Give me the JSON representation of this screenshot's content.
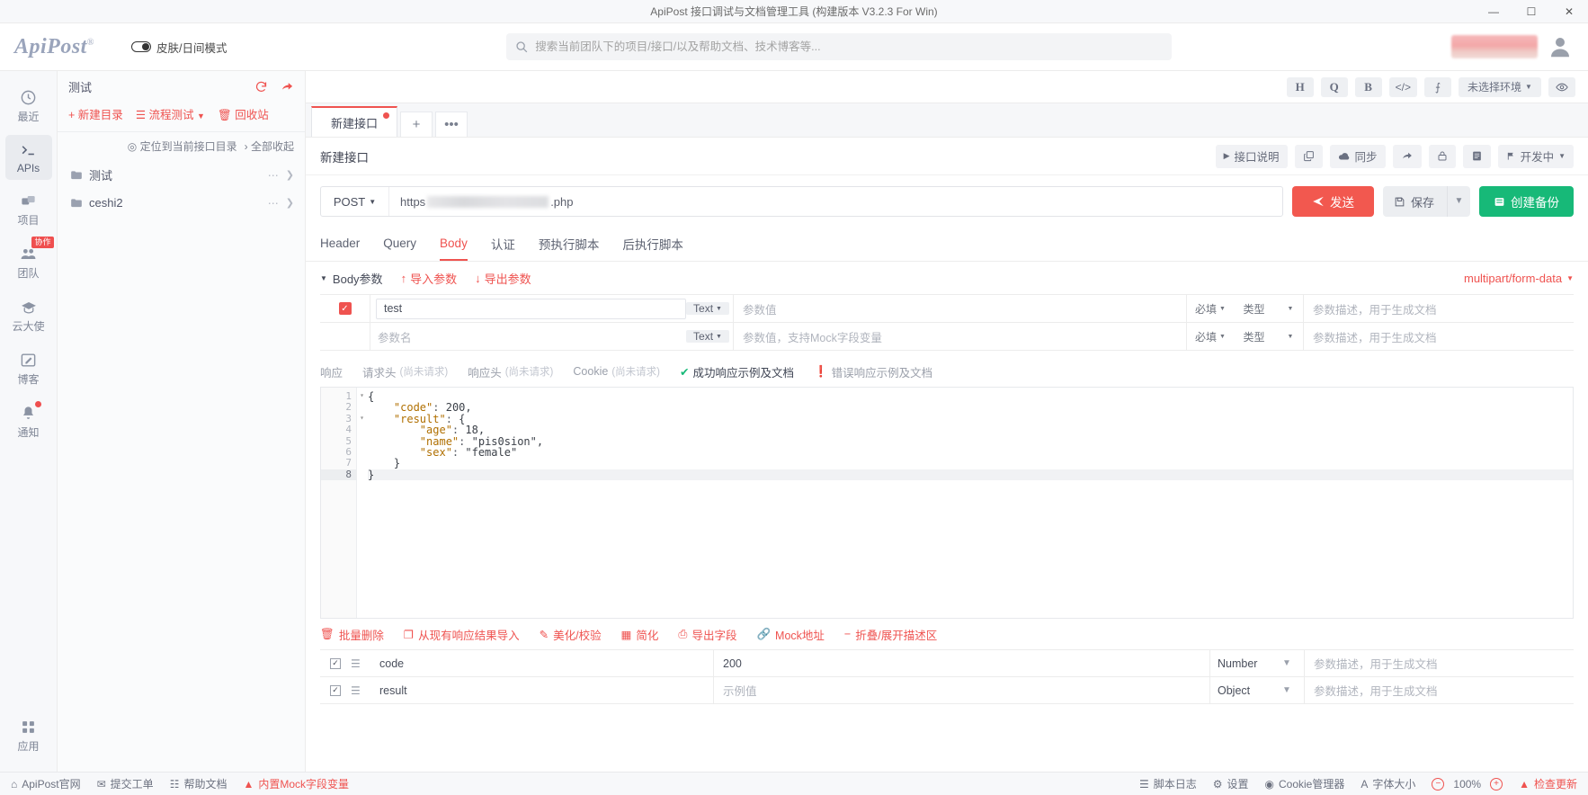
{
  "titlebar": {
    "title": "ApiPost 接口调试与文档管理工具 (构建版本 V3.2.3 For Win)",
    "minimize": "—",
    "maximize": "☐",
    "close": "✕"
  },
  "header": {
    "logo": "ApiPost",
    "logo_reg": "®",
    "skin_label": "皮肤/日间模式",
    "search_placeholder": "搜索当前团队下的项目/接口/以及帮助文档、技术博客等..."
  },
  "rail": {
    "items": [
      {
        "label": "最近",
        "icon": "clock-icon",
        "active": false
      },
      {
        "label": "APIs",
        "icon": "terminal-icon",
        "active": true
      },
      {
        "label": "项目",
        "icon": "project-icon",
        "active": false
      },
      {
        "label": "团队",
        "icon": "team-icon",
        "active": false,
        "badge": "协作"
      },
      {
        "label": "云大使",
        "icon": "graduation-icon",
        "active": false
      },
      {
        "label": "博客",
        "icon": "blog-icon",
        "active": false
      },
      {
        "label": "通知",
        "icon": "bell-icon",
        "active": false,
        "dot": true
      }
    ],
    "bottom": {
      "label": "应用",
      "icon": "apps-icon"
    }
  },
  "tree": {
    "project_name": "测试",
    "refresh_icon": "refresh-icon",
    "share_icon": "share-icon",
    "actions": [
      {
        "label": "新建目录",
        "icon": "plus-icon"
      },
      {
        "label": "流程测试",
        "icon": "flow-icon",
        "caret": true
      },
      {
        "label": "回收站",
        "icon": "trash-icon"
      }
    ],
    "locate_label": "定位到当前接口目录",
    "collapse_label": "全部收起",
    "folders": [
      {
        "name": "测试"
      },
      {
        "name": "ceshi2"
      }
    ]
  },
  "main": {
    "toptools": [
      {
        "label": "H",
        "name": "header-tool"
      },
      {
        "label": "Q",
        "name": "query-tool"
      },
      {
        "label": "B",
        "name": "body-tool"
      },
      {
        "label": "</>",
        "name": "code-tool"
      },
      {
        "label": "⨍",
        "name": "settings-tool"
      }
    ],
    "env_label": "未选择环境",
    "eye_icon": "eye-icon",
    "tabs": [
      {
        "label": "新建接口",
        "modified": true
      }
    ],
    "tab_add": "+",
    "tab_more": "•••",
    "api_name": "新建接口",
    "api_actions": [
      {
        "label": "接口说明",
        "icon": "play-icon"
      },
      {
        "label": "",
        "icon": "copy-icon"
      },
      {
        "label": "同步",
        "icon": "cloud-icon"
      },
      {
        "label": "",
        "icon": "share-icon"
      },
      {
        "label": "",
        "icon": "lock-icon"
      },
      {
        "label": "",
        "icon": "doc-icon"
      },
      {
        "label": "开发中",
        "icon": "flag-icon",
        "caret": true
      }
    ],
    "method": "POST",
    "url_prefix": "https",
    "url_suffix": ".php",
    "send_label": "发送",
    "save_label": "保存",
    "backup_label": "创建备份",
    "req_tabs": [
      {
        "label": "Header",
        "active": false
      },
      {
        "label": "Query",
        "active": false
      },
      {
        "label": "Body",
        "active": true
      },
      {
        "label": "认证",
        "active": false
      },
      {
        "label": "预执行脚本",
        "active": false
      },
      {
        "label": "后执行脚本",
        "active": false
      }
    ],
    "body_bar": {
      "title": "Body参数",
      "import": "导入参数",
      "export": "导出参数",
      "content_type": "multipart/form-data"
    },
    "param_table": {
      "rows": [
        {
          "checked": true,
          "key": "test",
          "key_placeholder": "",
          "type": "Text",
          "value_placeholder": "参数值",
          "required": "必填",
          "kind": "类型",
          "desc_placeholder": "参数描述，用于生成文档"
        },
        {
          "checked": false,
          "key": "",
          "key_placeholder": "参数名",
          "type": "Text",
          "value_placeholder": "参数值，支持Mock字段变量",
          "required": "必填",
          "kind": "类型",
          "desc_placeholder": "参数描述，用于生成文档"
        }
      ]
    },
    "resp_tabs": [
      {
        "label": "响应",
        "sub": "",
        "active": false
      },
      {
        "label": "请求头",
        "sub": "(尚未请求)",
        "active": false
      },
      {
        "label": "响应头",
        "sub": "(尚未请求)",
        "active": false
      },
      {
        "label": "Cookie",
        "sub": "(尚未请求)",
        "active": false
      },
      {
        "label": "成功响应示例及文档",
        "sub": "",
        "active": true,
        "status": "ok"
      },
      {
        "label": "错误响应示例及文档",
        "sub": "",
        "active": false,
        "status": "err"
      }
    ],
    "editor": {
      "lines": [
        "1",
        "2",
        "3",
        "4",
        "5",
        "6",
        "7",
        "8"
      ],
      "code_json": "{\n    \"code\": 200,\n    \"result\": {\n        \"age\": 18,\n        \"name\": \"pis0sion\",\n        \"sex\": \"female\"\n    }\n}",
      "current_line": 8
    },
    "editor_tools": [
      {
        "label": "批量删除",
        "icon": "trash-icon"
      },
      {
        "label": "从现有响应结果导入",
        "icon": "import-icon"
      },
      {
        "label": "美化/校验",
        "icon": "wand-icon"
      },
      {
        "label": "简化",
        "icon": "simplify-icon"
      },
      {
        "label": "导出字段",
        "icon": "export-icon"
      },
      {
        "label": "Mock地址",
        "icon": "link-icon"
      },
      {
        "label": "折叠/展开描述区",
        "icon": "collapse-icon"
      }
    ],
    "field_table": {
      "rows": [
        {
          "checked": true,
          "name": "code",
          "value": "200",
          "value_is_placeholder": false,
          "type": "Number",
          "desc_placeholder": "参数描述，用于生成文档"
        },
        {
          "checked": true,
          "name": "result",
          "value": "示例值",
          "value_is_placeholder": true,
          "type": "Object",
          "desc_placeholder": "参数描述，用于生成文档"
        }
      ]
    }
  },
  "statusbar": {
    "left": [
      {
        "label": "ApiPost官网",
        "icon": "home-icon"
      },
      {
        "label": "提交工单",
        "icon": "ticket-icon"
      },
      {
        "label": "帮助文档",
        "icon": "book-icon"
      },
      {
        "label": "内置Mock字段变量",
        "icon": "mock-icon",
        "red": true
      }
    ],
    "right": [
      {
        "label": "脚本日志",
        "icon": "log-icon"
      },
      {
        "label": "设置",
        "icon": "gear-icon"
      },
      {
        "label": "Cookie管理器",
        "icon": "cookie-icon"
      },
      {
        "label": "字体大小",
        "icon": "font-icon"
      }
    ],
    "zoom_minus": "−",
    "zoom_value": "100%",
    "zoom_plus": "+",
    "update_label": "检查更新"
  }
}
